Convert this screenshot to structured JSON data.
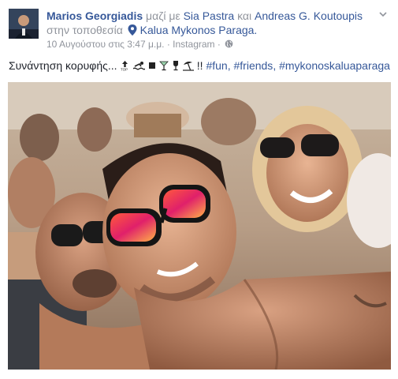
{
  "post": {
    "author": "Marios Georgiadis",
    "with_word": "μαζί με",
    "tag1": "Sia Pastra",
    "and_word": "και",
    "tag2": "Andreas G. Koutoupis",
    "location_prefix": "στην τοποθεσία",
    "location": "Kalua Mykonos Paraga.",
    "timestamp": "10 Αυγούστου στις 3:47 μ.μ.",
    "source_sep": "·",
    "source": "Instagram",
    "audience_sep": "·",
    "text": "Συνάντηση κορυφής... ",
    "emoji_icons": [
      "top-arrow-icon",
      "swimmer-icon",
      "black-square-icon",
      "cocktail-icon",
      "wine-glass-icon",
      "beach-umbrella-icon"
    ],
    "exclaim": "!!",
    "hashtags": [
      "#fun",
      "#friends",
      "#mykonoskaluaparaga"
    ],
    "hashtag_sep": ", "
  },
  "colors": {
    "link": "#365899",
    "meta": "#90949c",
    "text": "#1d2129"
  }
}
